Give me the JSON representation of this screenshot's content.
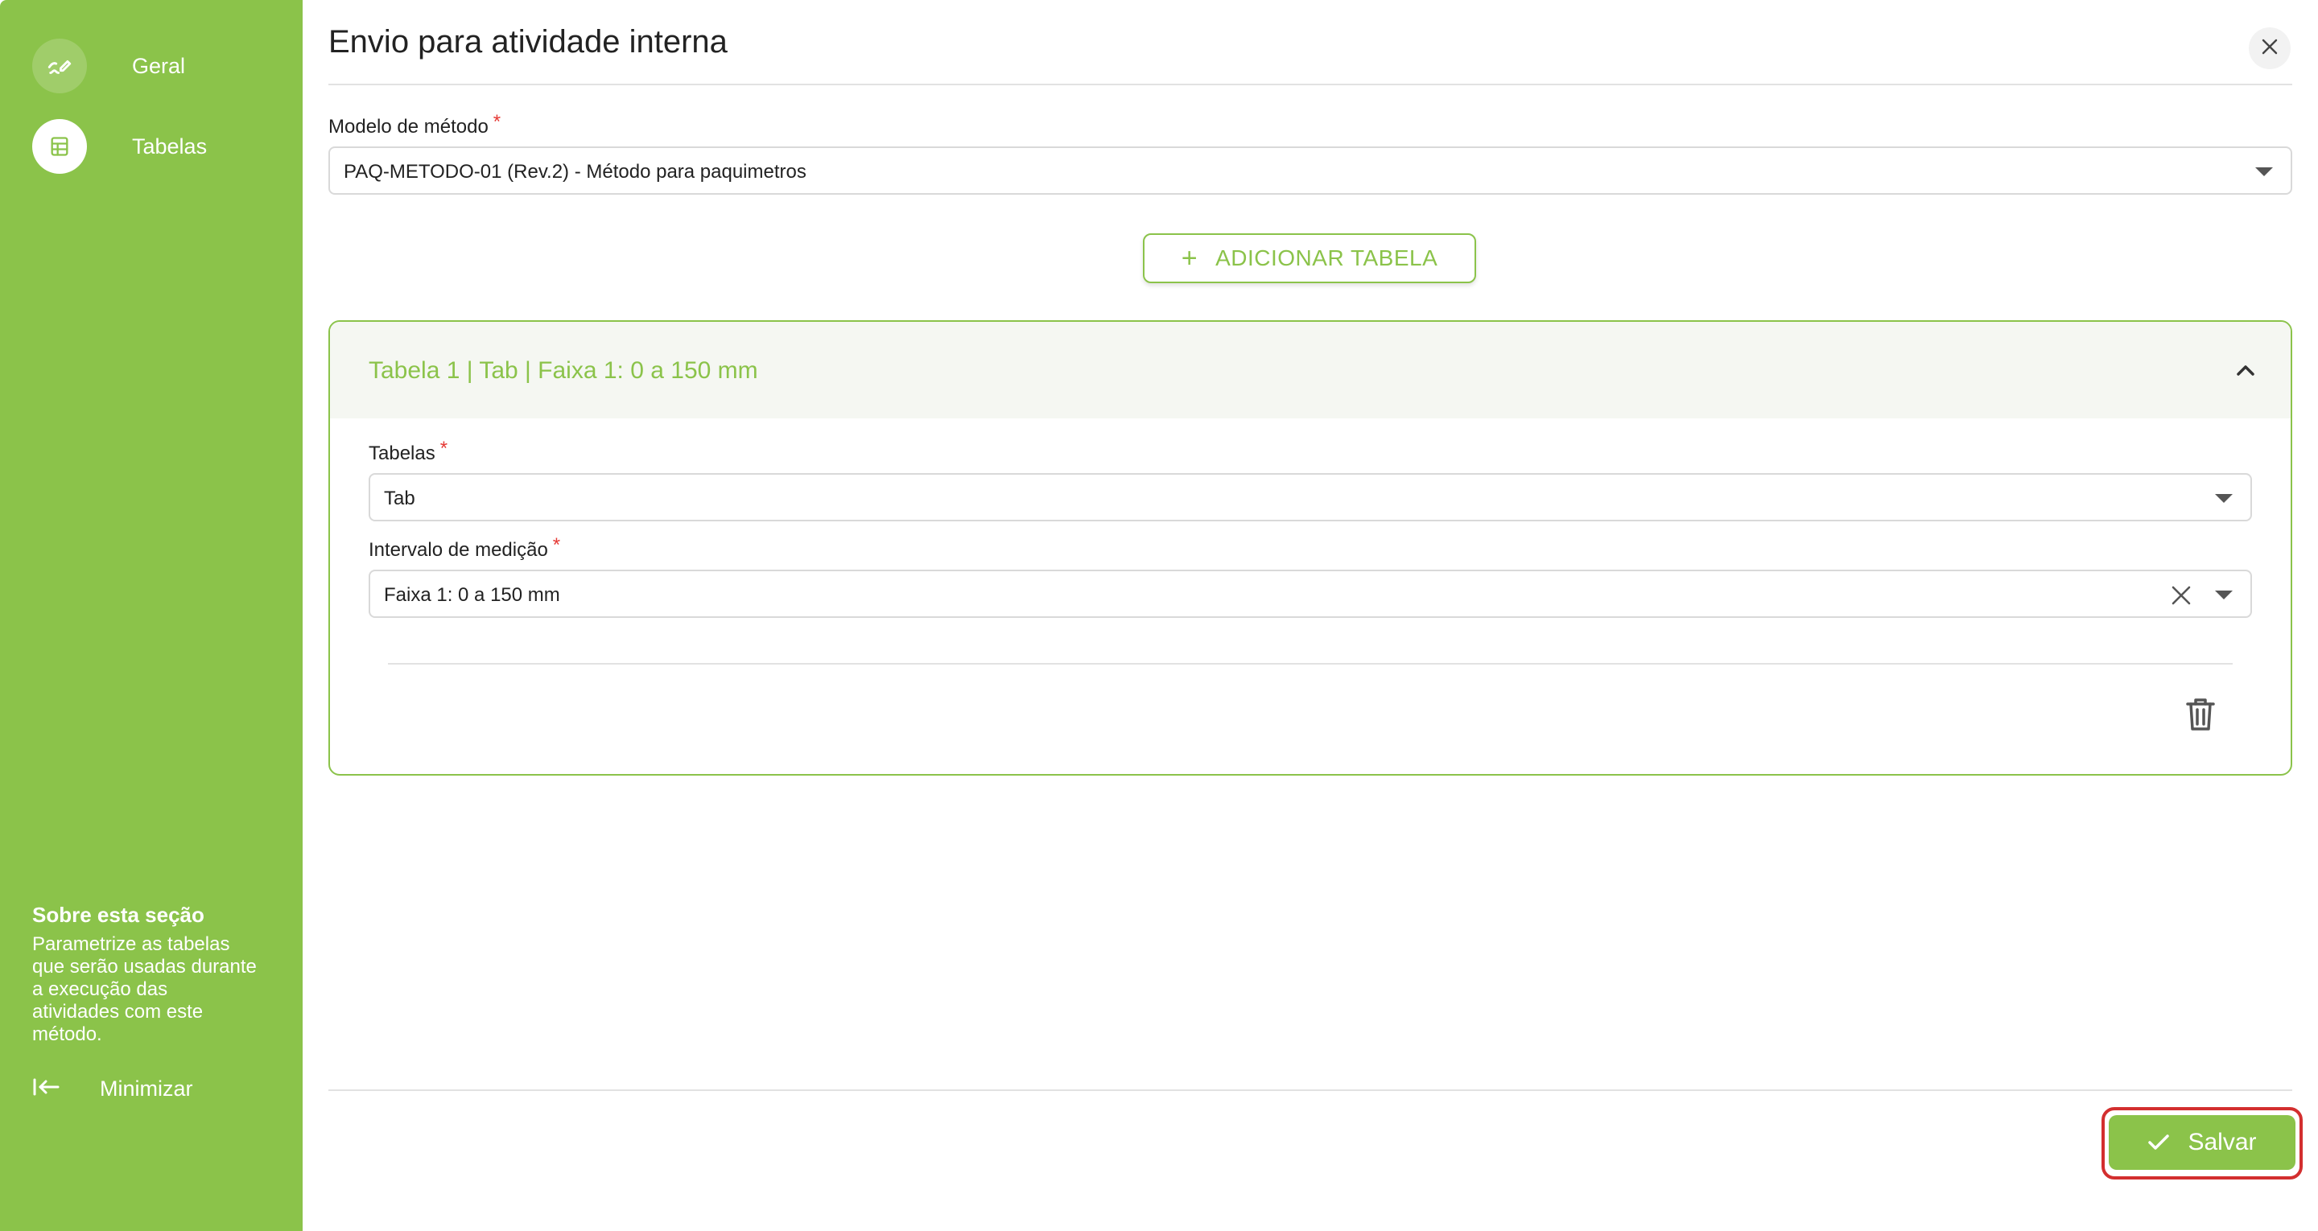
{
  "sidebar": {
    "items": [
      {
        "label": "Geral",
        "icon": "edit-pen-icon"
      },
      {
        "label": "Tabelas",
        "icon": "table-icon"
      }
    ],
    "about_title": "Sobre esta seção",
    "about_text": "Parametrize as tabelas que serão usadas durante a execução das atividades com este método.",
    "minimize_label": "Minimizar"
  },
  "header": {
    "title": "Envio para atividade interna"
  },
  "form": {
    "method_model_label": "Modelo de método",
    "method_model_value": "PAQ-METODO-01 (Rev.2) - Método para paquimetros",
    "add_table_label": "ADICIONAR TABELA",
    "required_mark": "*"
  },
  "table_panel": {
    "title": "Tabela 1 | Tab | Faixa 1: 0 a 150 mm",
    "tables_label": "Tabelas",
    "tables_value": "Tab",
    "interval_label": "Intervalo de medição",
    "interval_value": "Faixa 1: 0 a 150 mm"
  },
  "footer": {
    "save_label": "Salvar"
  },
  "colors": {
    "accent": "#8bc34a",
    "required": "#e53935",
    "highlight_outline": "#d32f2f"
  }
}
